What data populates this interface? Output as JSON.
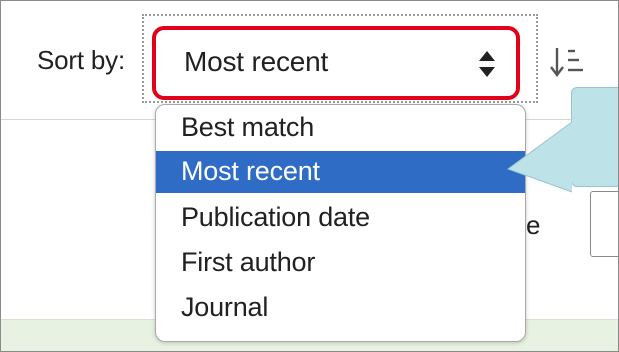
{
  "sort": {
    "label": "Sort by:",
    "selected_value": "Most recent",
    "options": [
      {
        "label": "Best match",
        "selected": false
      },
      {
        "label": "Most recent",
        "selected": true
      },
      {
        "label": "Publication date",
        "selected": false
      },
      {
        "label": "First author",
        "selected": false
      },
      {
        "label": "Journal",
        "selected": false
      }
    ]
  },
  "partial_text": "e",
  "icons": {
    "select_arrows": "up-down-caret-icon",
    "sort_order": "sort-order-icon"
  },
  "colors": {
    "highlight_border": "#e3001b",
    "selected_option_bg": "#2f6cc6",
    "hint_callout": "#bde2e8",
    "footer_band": "#e8f2e3"
  }
}
